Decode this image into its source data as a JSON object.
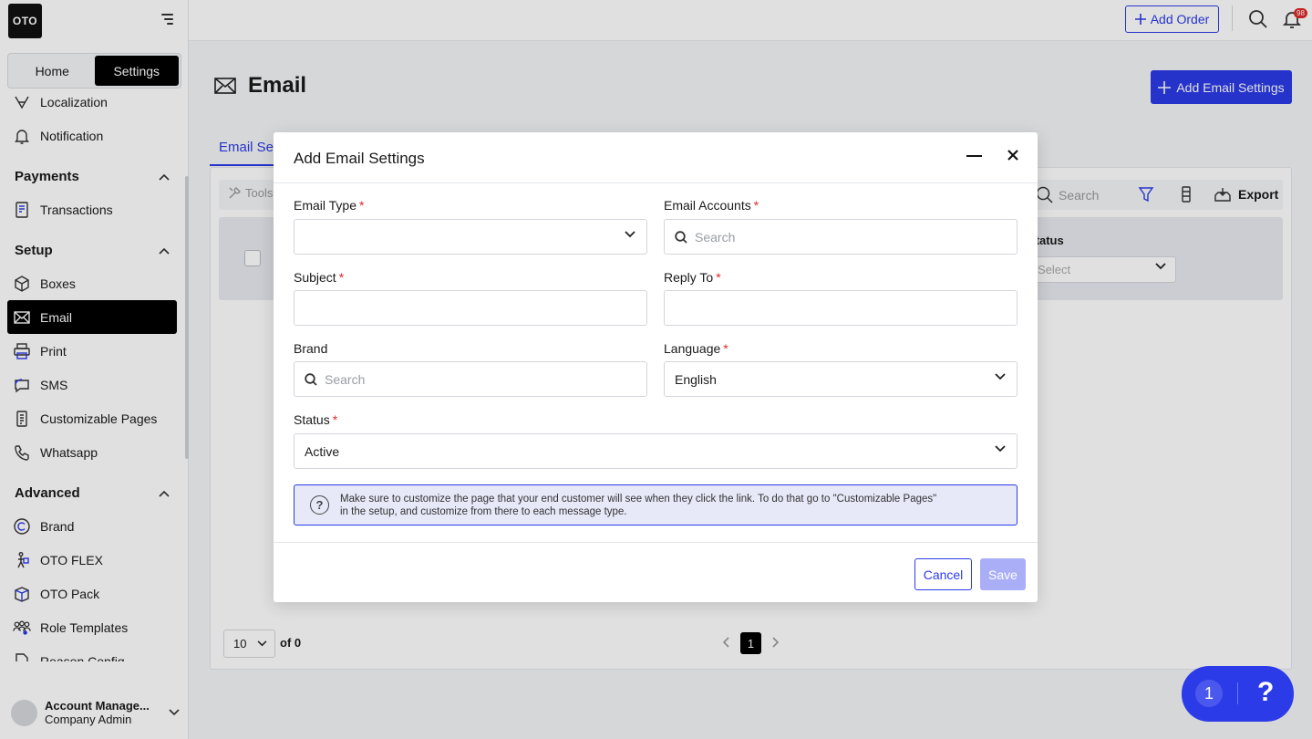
{
  "app": {
    "logo_text": "OTO"
  },
  "sidebar": {
    "mode_tabs": [
      {
        "label": "Home"
      },
      {
        "label": "Settings"
      }
    ],
    "active_mode": "Settings",
    "items_top": [
      {
        "label": "Localization",
        "icon": "localization-icon"
      },
      {
        "label": "Notification",
        "icon": "bell-icon"
      }
    ],
    "sections": {
      "payments": {
        "label": "Payments",
        "items": [
          {
            "label": "Transactions",
            "icon": "transactions-icon"
          }
        ]
      },
      "setup": {
        "label": "Setup",
        "items": [
          {
            "label": "Boxes",
            "icon": "box-icon"
          },
          {
            "label": "Email",
            "icon": "mail-icon",
            "active": true
          },
          {
            "label": "Print",
            "icon": "printer-icon"
          },
          {
            "label": "SMS",
            "icon": "sms-icon"
          },
          {
            "label": "Customizable Pages",
            "icon": "pages-icon"
          },
          {
            "label": "Whatsapp",
            "icon": "phone-icon"
          }
        ]
      },
      "advanced": {
        "label": "Advanced",
        "items": [
          {
            "label": "Brand",
            "icon": "copyright-icon"
          },
          {
            "label": "OTO FLEX",
            "icon": "flex-icon"
          },
          {
            "label": "OTO Pack",
            "icon": "pack-icon"
          },
          {
            "label": "Role Templates",
            "icon": "roles-icon"
          },
          {
            "label": "Reason Config",
            "icon": "config-icon"
          }
        ]
      }
    },
    "user": {
      "name": "Account Manage...",
      "role": "Company Admin"
    }
  },
  "topbar": {
    "add_order_label": "Add Order",
    "notification_count": "98"
  },
  "page": {
    "title": "Email",
    "add_button_label": "Add Email Settings",
    "tab_label": "Email Settings",
    "toolbar": {
      "tools_label": "Tools",
      "search_placeholder": "Search",
      "export_label": "Export"
    },
    "table": {
      "status_column": "Status",
      "status_select_placeholder": "Select"
    },
    "pagination": {
      "page_size": "10",
      "of_label": "of 0",
      "current_page": "1"
    }
  },
  "modal": {
    "title": "Add Email Settings",
    "fields": {
      "email_type": {
        "label": "Email Type",
        "value": ""
      },
      "email_accounts": {
        "label": "Email Accounts",
        "placeholder": "Search"
      },
      "subject": {
        "label": "Subject",
        "value": ""
      },
      "reply_to": {
        "label": "Reply To",
        "value": ""
      },
      "brand": {
        "label": "Brand",
        "placeholder": "Search"
      },
      "language": {
        "label": "Language",
        "value": "English"
      },
      "status": {
        "label": "Status",
        "value": "Active"
      }
    },
    "required_marker": "*",
    "info_text_line1": "Make sure to customize the page that your end customer will see when they click the link. To do that go to \"Customizable Pages\"",
    "info_text_line2": "in the setup, and customize from there to each message type.",
    "cancel_label": "Cancel",
    "save_label": "Save"
  },
  "help_widget": {
    "count": "1",
    "icon_text": "?"
  },
  "colors": {
    "primary": "#2b3be8",
    "save_disabled": "#a9aef7",
    "required": "#e02828",
    "info_bg": "#e7e8f8"
  }
}
